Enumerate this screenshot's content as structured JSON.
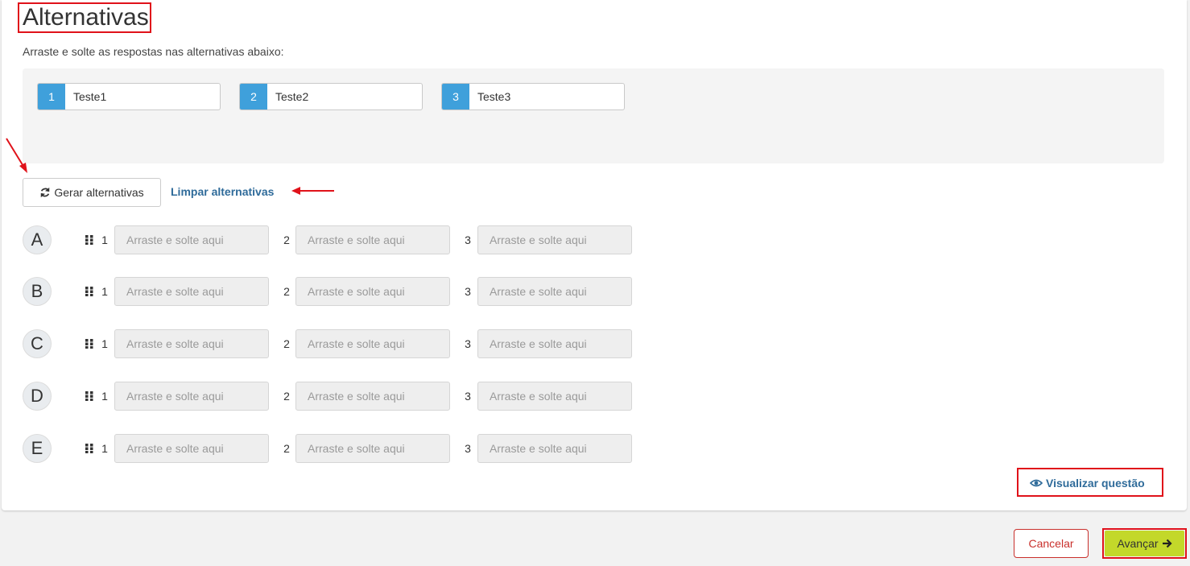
{
  "page": {
    "title": "Alternativas",
    "instruction": "Arraste e solte as respostas nas alternativas abaixo:"
  },
  "options": [
    {
      "number": "1",
      "text": "Teste1"
    },
    {
      "number": "2",
      "text": "Teste2"
    },
    {
      "number": "3",
      "text": "Teste3"
    }
  ],
  "actions": {
    "generate_label": "Gerar alternativas",
    "generate_icon": "refresh-icon",
    "clear_label": "Limpar alternativas"
  },
  "rows": [
    {
      "letter": "A",
      "slots": [
        {
          "number": "1",
          "placeholder": "Arraste e solte aqui"
        },
        {
          "number": "2",
          "placeholder": "Arraste e solte aqui"
        },
        {
          "number": "3",
          "placeholder": "Arraste e solte aqui"
        }
      ]
    },
    {
      "letter": "B",
      "slots": [
        {
          "number": "1",
          "placeholder": "Arraste e solte aqui"
        },
        {
          "number": "2",
          "placeholder": "Arraste e solte aqui"
        },
        {
          "number": "3",
          "placeholder": "Arraste e solte aqui"
        }
      ]
    },
    {
      "letter": "C",
      "slots": [
        {
          "number": "1",
          "placeholder": "Arraste e solte aqui"
        },
        {
          "number": "2",
          "placeholder": "Arraste e solte aqui"
        },
        {
          "number": "3",
          "placeholder": "Arraste e solte aqui"
        }
      ]
    },
    {
      "letter": "D",
      "slots": [
        {
          "number": "1",
          "placeholder": "Arraste e solte aqui"
        },
        {
          "number": "2",
          "placeholder": "Arraste e solte aqui"
        },
        {
          "number": "3",
          "placeholder": "Arraste e solte aqui"
        }
      ]
    },
    {
      "letter": "E",
      "slots": [
        {
          "number": "1",
          "placeholder": "Arraste e solte aqui"
        },
        {
          "number": "2",
          "placeholder": "Arraste e solte aqui"
        },
        {
          "number": "3",
          "placeholder": "Arraste e solte aqui"
        }
      ]
    }
  ],
  "preview": {
    "label": "Visualizar questão",
    "icon": "eye-icon"
  },
  "footer": {
    "cancel_label": "Cancelar",
    "next_label": "Avançar",
    "next_icon": "arrow-right-icon"
  },
  "colors": {
    "accent_blue": "#3fa0db",
    "link_blue": "#2f6b9a",
    "next_green": "#c3d82a",
    "cancel_red": "#c9302c",
    "annotation_red": "#e0121a"
  }
}
